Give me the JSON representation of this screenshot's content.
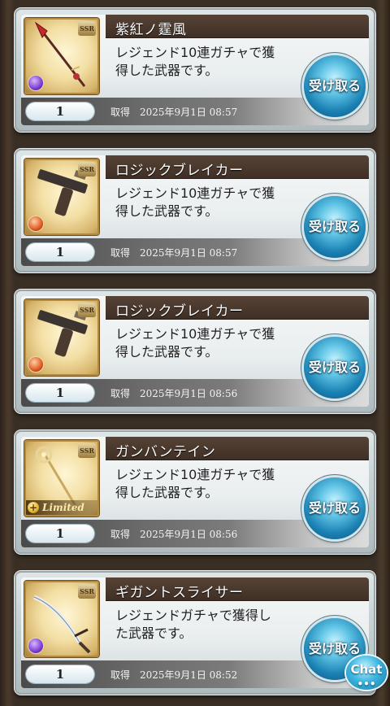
{
  "items": [
    {
      "name": "紫紅ノ霆風",
      "description_line1": "レジェンド10連ガチャで獲",
      "description_line2": "得した武器です。",
      "quantity": "1",
      "acquired_label": "取得",
      "acquired_date": "2025年9月1日 08:57",
      "receive_label": "受け取る",
      "rarity": "SSR",
      "element": "dark",
      "weapon_icon": "spear-icon"
    },
    {
      "name": "ロジックブレイカー",
      "description_line1": "レジェンド10連ガチャで獲",
      "description_line2": "得した武器です。",
      "quantity": "1",
      "acquired_label": "取得",
      "acquired_date": "2025年9月1日 08:57",
      "receive_label": "受け取る",
      "rarity": "SSR",
      "element": "fire",
      "weapon_icon": "gun-icon"
    },
    {
      "name": "ロジックブレイカー",
      "description_line1": "レジェンド10連ガチャで獲",
      "description_line2": "得した武器です。",
      "quantity": "1",
      "acquired_label": "取得",
      "acquired_date": "2025年9月1日 08:56",
      "receive_label": "受け取る",
      "rarity": "SSR",
      "element": "fire",
      "weapon_icon": "gun-icon"
    },
    {
      "name": "ガンバンテイン",
      "description_line1": "レジェンド10連ガチャで獲",
      "description_line2": "得した武器です。",
      "quantity": "1",
      "acquired_label": "取得",
      "acquired_date": "2025年9月1日 08:56",
      "receive_label": "受け取る",
      "rarity": "SSR",
      "element": "light",
      "limited_label": "Limited",
      "weapon_icon": "staff-icon"
    },
    {
      "name": "ギガントスライサー",
      "description_line1": "レジェンドガチャで獲得し",
      "description_line2": "た武器です。",
      "quantity": "1",
      "acquired_label": "取得",
      "acquired_date": "2025年9月1日 08:52",
      "receive_label": "受け取る",
      "rarity": "SSR",
      "element": "dark",
      "weapon_icon": "sword-icon"
    }
  ],
  "chat_button": {
    "label": "Chat",
    "dots": "•••"
  }
}
